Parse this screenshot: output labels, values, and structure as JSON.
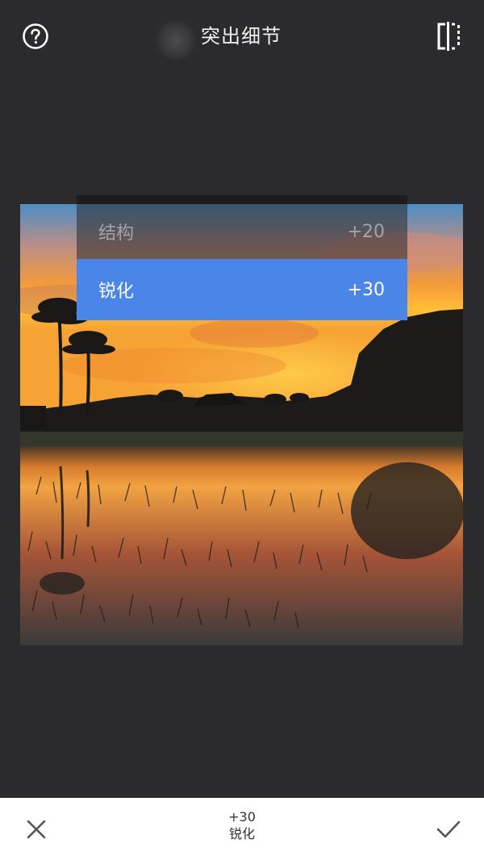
{
  "header": {
    "title": "突出细节",
    "help_icon": "question-circle-icon",
    "compare_icon": "compare-split-icon"
  },
  "adjust_menu": {
    "items": [
      {
        "label": "结构",
        "value": "+20",
        "selected": false
      },
      {
        "label": "锐化",
        "value": "+30",
        "selected": true
      }
    ]
  },
  "footer": {
    "current_value": "+30",
    "current_label": "锐化",
    "cancel_icon": "close-icon",
    "apply_icon": "check-icon"
  },
  "colors": {
    "background": "#2b2a2c",
    "accent": "#4a86e8",
    "footer_bg": "#ffffff"
  }
}
